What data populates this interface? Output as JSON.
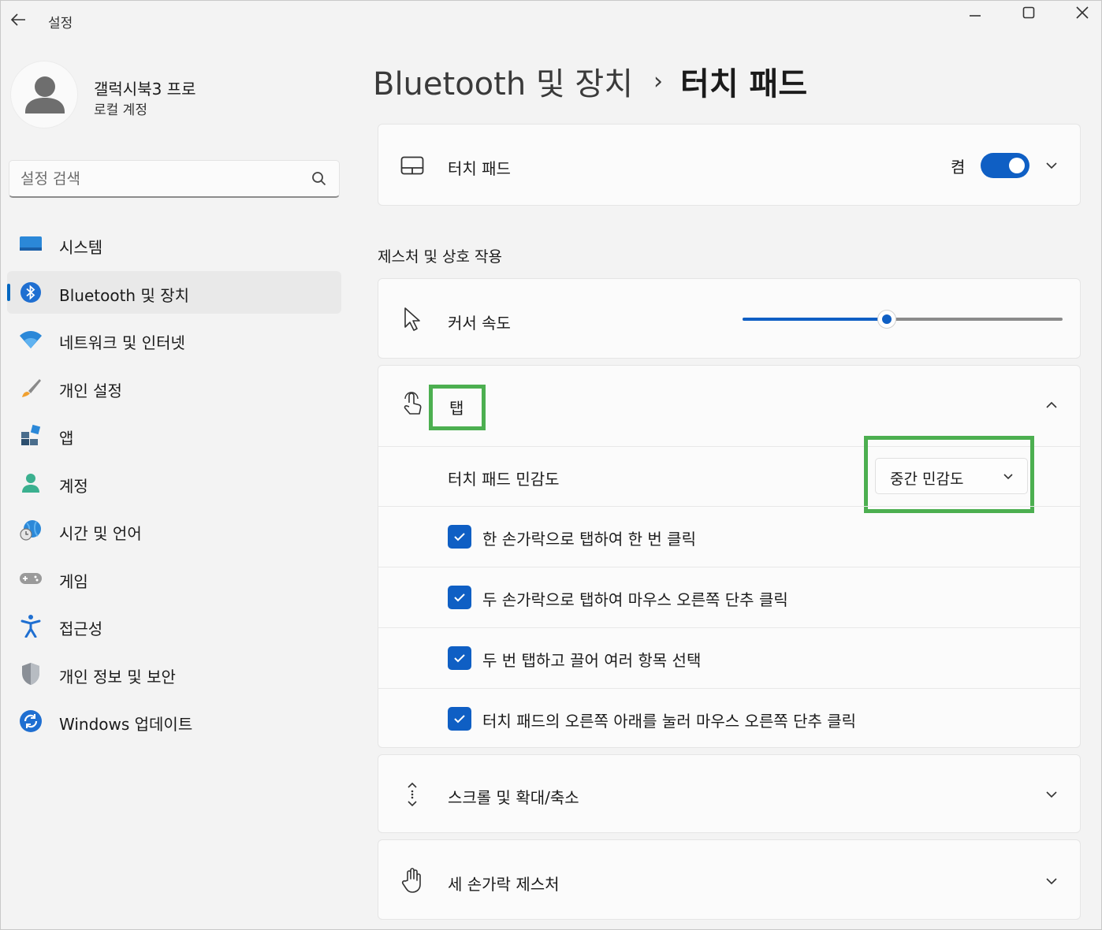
{
  "window": {
    "title": "설정",
    "back_icon": "arrow-left-icon",
    "controls": [
      "minimize-icon",
      "maximize-icon",
      "close-icon"
    ]
  },
  "profile": {
    "name": "갤럭시북3 프로",
    "account_type": "로컬 계정"
  },
  "search": {
    "placeholder": "설정 검색"
  },
  "sidebar": {
    "items": [
      {
        "label": "시스템",
        "icon": "system-monitor-icon",
        "active": false
      },
      {
        "label": "Bluetooth 및 장치",
        "icon": "bluetooth-icon",
        "active": true
      },
      {
        "label": "네트워크 및 인터넷",
        "icon": "wifi-icon",
        "active": false
      },
      {
        "label": "개인 설정",
        "icon": "paintbrush-icon",
        "active": false
      },
      {
        "label": "앱",
        "icon": "apps-icon",
        "active": false
      },
      {
        "label": "계정",
        "icon": "person-icon",
        "active": false
      },
      {
        "label": "시간 및 언어",
        "icon": "globe-clock-icon",
        "active": false
      },
      {
        "label": "게임",
        "icon": "gamepad-icon",
        "active": false
      },
      {
        "label": "접근성",
        "icon": "accessibility-icon",
        "active": false
      },
      {
        "label": "개인 정보 및 보안",
        "icon": "shield-icon",
        "active": false
      },
      {
        "label": "Windows 업데이트",
        "icon": "update-icon",
        "active": false
      }
    ]
  },
  "breadcrumb": {
    "parent": "Bluetooth 및 장치",
    "separator": "›",
    "current": "터치 패드"
  },
  "touchpad": {
    "label": "터치 패드",
    "toggle_state_label": "켬",
    "toggle_on": true
  },
  "gestures_section": {
    "title": "제스처 및 상호 작용",
    "cursor_speed": {
      "label": "커서 속도",
      "value_fraction": 0.45
    },
    "taps": {
      "label": "탭",
      "sensitivity": {
        "label": "터치 패드 민감도",
        "value": "중간 민감도"
      },
      "options": [
        {
          "label": "한 손가락으로 탭하여 한 번 클릭",
          "checked": true
        },
        {
          "label": "두 손가락으로 탭하여 마우스 오른쪽 단추 클릭",
          "checked": true
        },
        {
          "label": "두 번 탭하고 끌어 여러 항목 선택",
          "checked": true
        },
        {
          "label": "터치 패드의 오른쪽 아래를 눌러 마우스 오른쪽 단추 클릭",
          "checked": true
        }
      ]
    },
    "scroll_zoom": {
      "label": "스크롤 및 확대/축소"
    },
    "three_finger": {
      "label": "세 손가락 제스처"
    }
  },
  "colors": {
    "accent": "#0f5fc4",
    "highlight": "#4caf50"
  }
}
